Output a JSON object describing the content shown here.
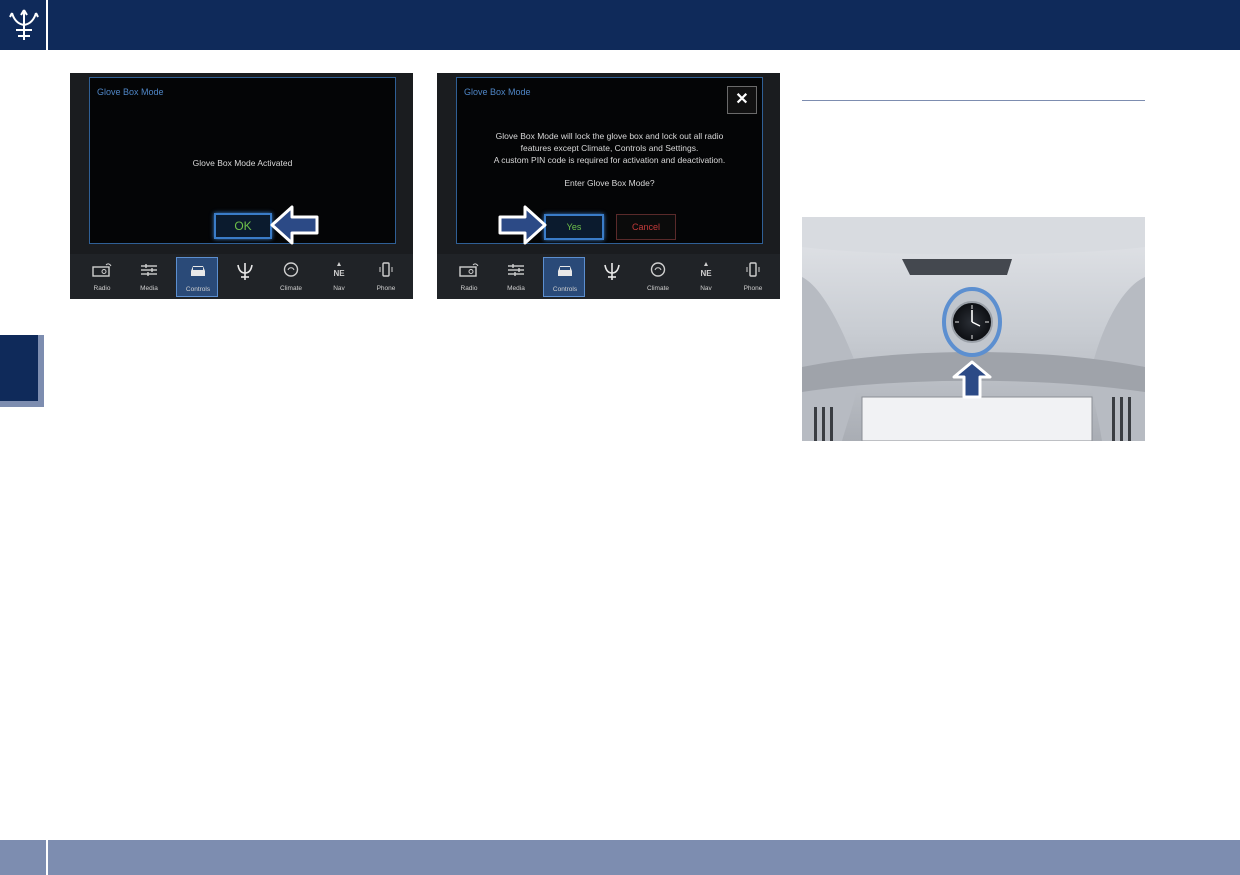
{
  "header": {
    "logo": "maserati-trident-logo"
  },
  "screen_left": {
    "dialog_title": "Glove Box Mode",
    "message": "Glove Box Mode Activated",
    "ok_label": "OK",
    "nav": [
      {
        "label": "Radio",
        "icon": "radio-icon"
      },
      {
        "label": "Media",
        "icon": "media-icon"
      },
      {
        "label": "Controls",
        "icon": "car-icon"
      },
      {
        "label": "",
        "icon": "trident-icon"
      },
      {
        "label": "Climate",
        "icon": "climate-icon"
      },
      {
        "label": "Nav",
        "icon": "compass-icon"
      },
      {
        "label": "Phone",
        "icon": "phone-icon"
      }
    ]
  },
  "screen_right": {
    "dialog_title": "Glove Box Mode",
    "message_lines": [
      "Glove Box Mode will lock the glove box and lock out all radio",
      "features except Climate, Controls and Settings.",
      "A custom PIN code is required for activation and deactivation."
    ],
    "question": "Enter Glove Box Mode?",
    "yes_label": "Yes",
    "cancel_label": "Cancel",
    "close_label": "✕",
    "nav": [
      {
        "label": "Radio",
        "icon": "radio-icon"
      },
      {
        "label": "Media",
        "icon": "media-icon"
      },
      {
        "label": "Controls",
        "icon": "car-icon"
      },
      {
        "label": "",
        "icon": "trident-icon"
      },
      {
        "label": "Climate",
        "icon": "climate-icon"
      },
      {
        "label": "Nav",
        "icon": "compass-icon"
      },
      {
        "label": "Phone",
        "icon": "phone-icon"
      }
    ]
  },
  "photo": {
    "subject": "dashboard-clock"
  },
  "colors": {
    "brand_navy": "#0f2a5a",
    "accent_gray_blue": "#7d8db0",
    "ok_green": "#6ec04a",
    "cancel_red": "#c23a3a"
  }
}
